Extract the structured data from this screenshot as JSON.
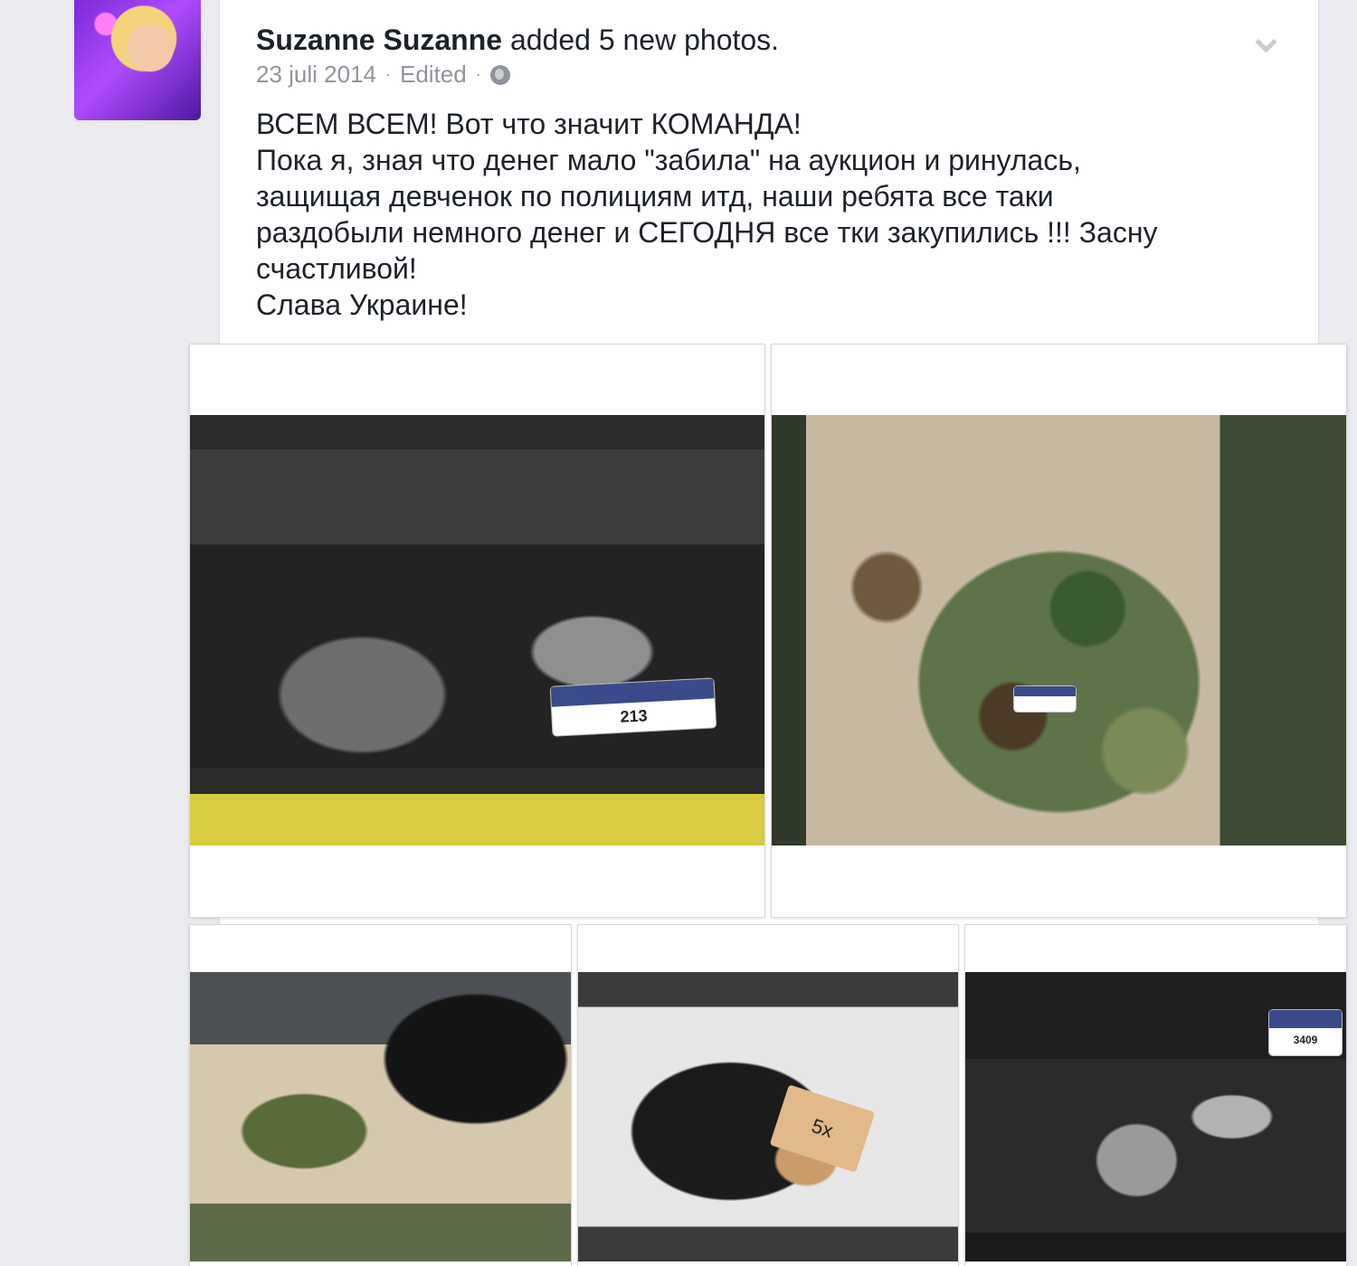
{
  "post": {
    "author": "Suzanne Suzanne",
    "action": " added 5 new photos.",
    "date": "23 juli 2014",
    "edited": "Edited",
    "separator": "·",
    "privacy_icon": "globe-icon",
    "menu_icon": "chevron-down-icon",
    "text_lines": [
      "ВСЕМ ВСЕМ! Вот что значит КОМАНДА!",
      "Пока я, зная что денег мало \"забила\" на аукцион и ринулась,",
      "защищая девченок по полициям итд, наши ребята все таки",
      "раздобыли немного денег и СЕГОДНЯ все тки закупились !!! Засну",
      "счастливой!",
      "Слава Украине!"
    ]
  },
  "photos": [
    {
      "id": "photo-1",
      "tag_number": "213"
    },
    {
      "id": "photo-2",
      "tag_number": ""
    },
    {
      "id": "photo-3",
      "tag_number": ""
    },
    {
      "id": "photo-4",
      "tag_number": "5x"
    },
    {
      "id": "photo-5",
      "tag_number": "3409"
    }
  ],
  "colors": {
    "background": "#e9ebee",
    "card": "#ffffff",
    "text": "#1d2129",
    "meta": "#90949c"
  }
}
